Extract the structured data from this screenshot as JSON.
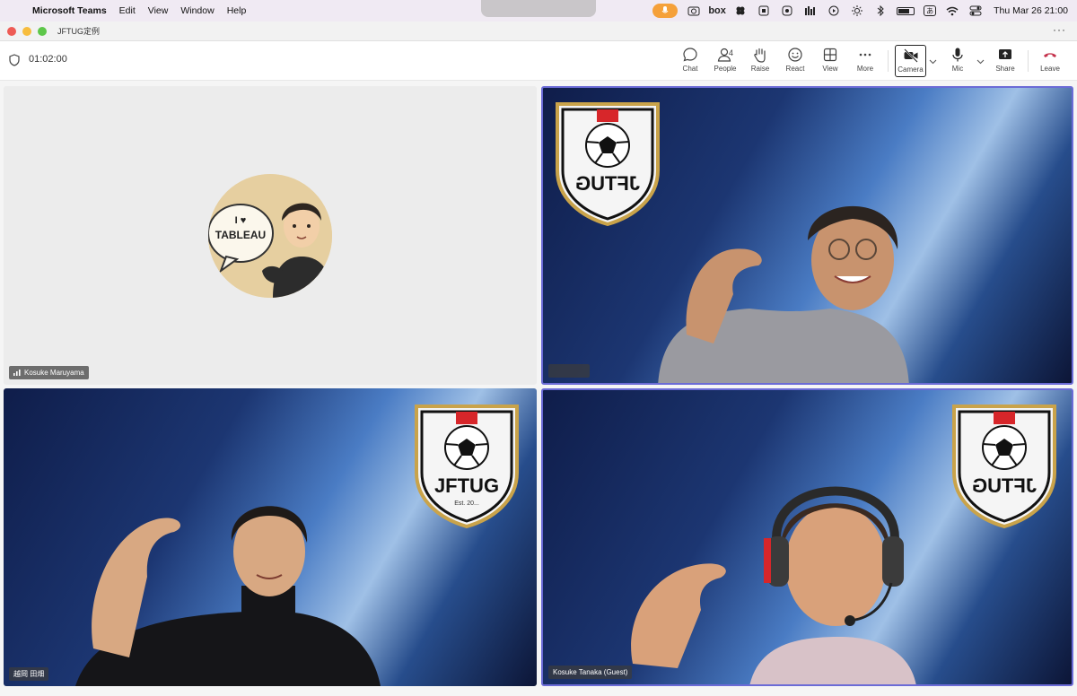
{
  "menubar": {
    "app_name": "Microsoft Teams",
    "items": [
      "Edit",
      "View",
      "Window",
      "Help"
    ],
    "box_label": "box",
    "ime_label": "あ",
    "datetime": "Thu Mar 26  21:00"
  },
  "window": {
    "title": "JFTUG定例",
    "more": "···"
  },
  "toolbar": {
    "timer": "01:02:00",
    "chat": "Chat",
    "people": "People",
    "people_count": "4",
    "raise": "Raise",
    "react": "React",
    "view": "View",
    "more": "More",
    "camera": "Camera",
    "mic": "Mic",
    "share": "Share",
    "leave": "Leave"
  },
  "avatar": {
    "text_line1": "I ♥",
    "text_line2": "TABLEAU"
  },
  "crest": {
    "wordmark": "JFTUG",
    "wordmark_mirrored": "JFTUG",
    "est": "Est. 20..."
  },
  "participants": [
    {
      "name": "Kosuke Maruyama"
    },
    {
      "name": ""
    },
    {
      "name": "越岡 田畑"
    },
    {
      "name": "Kosuke Tanaka (Guest)"
    }
  ],
  "colors": {
    "accent": "#6b6bd6",
    "leave_red": "#c4314b",
    "crest_red": "#d7262a",
    "crest_gold": "#c9a34a"
  }
}
